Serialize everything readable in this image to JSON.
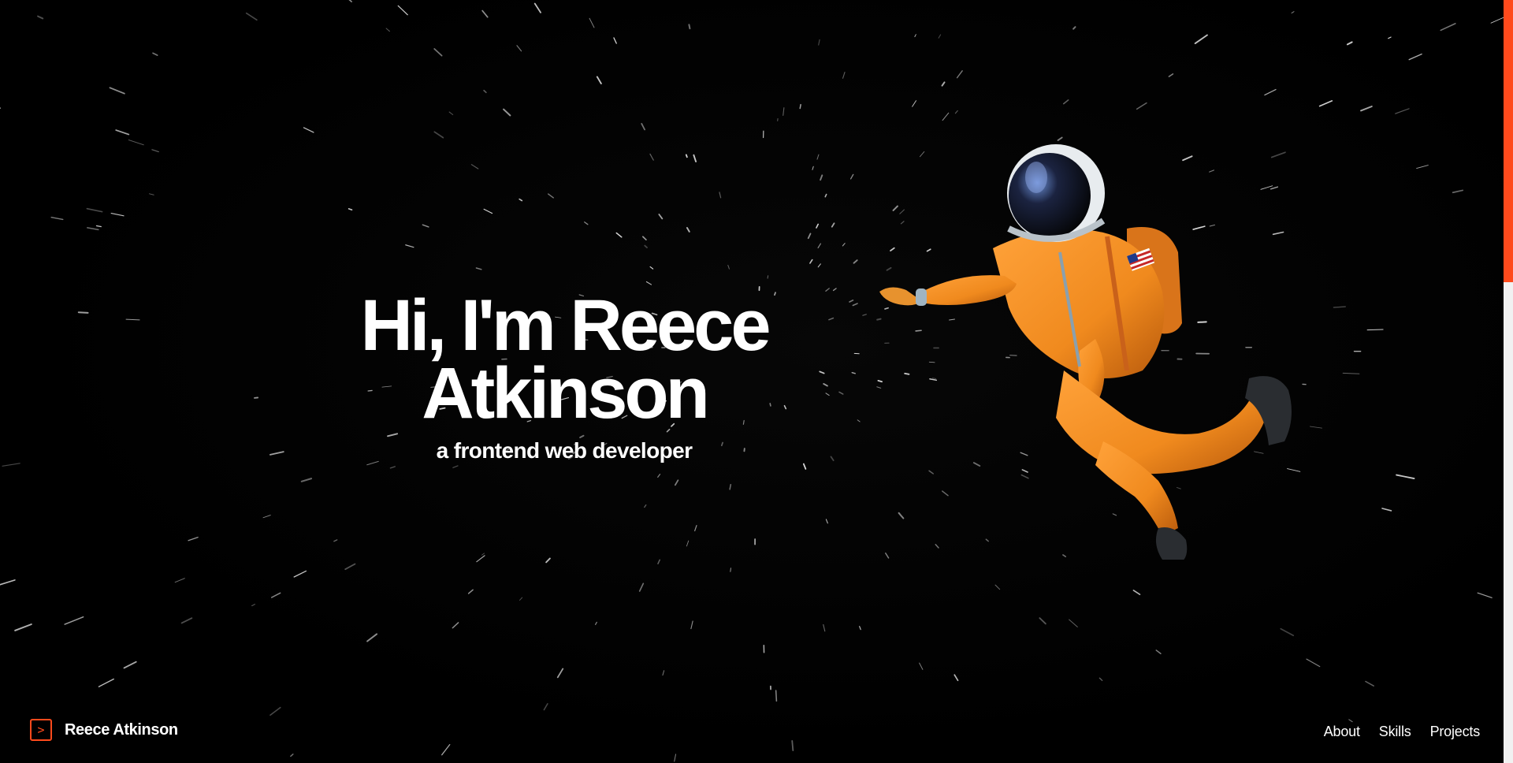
{
  "hero": {
    "title_line1": "Hi, I'm Reece",
    "title_line2": "Atkinson",
    "subtitle": "a frontend web developer"
  },
  "footer": {
    "brand_icon": "terminal-chevron-icon",
    "brand_name": "Reece Atkinson",
    "nav": [
      "About",
      "Skills",
      "Projects"
    ]
  },
  "scrollbar": {
    "position_fraction": 0.0,
    "visible_fraction": 0.37
  },
  "colors": {
    "background": "#000000",
    "text": "#ffffff",
    "accent": "#ff4a1c",
    "suit_orange": "#f08a1e",
    "scroll_track": "#f1f1f1"
  }
}
